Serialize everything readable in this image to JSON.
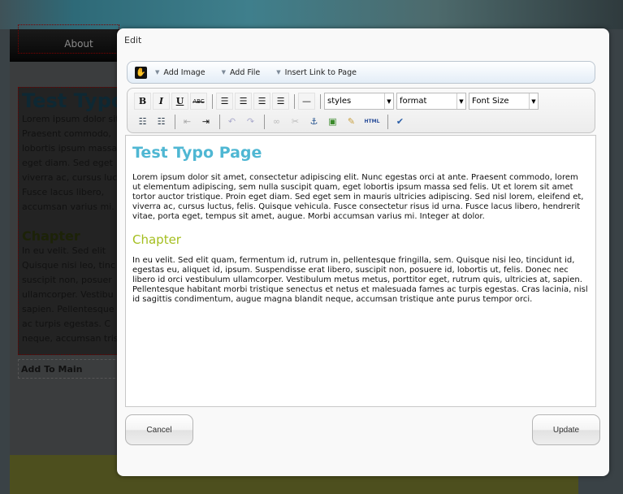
{
  "background_page": {
    "nav_item": "About",
    "content_title": "Test Typo",
    "content_lines": [
      "Lorem ipsum dolor sit",
      "Praesent commodo,",
      "lobortis ipsum massa",
      "eget diam. Sed eget",
      "viverra ac, cursus luc",
      "Fusce lacus libero,",
      "accumsan varius mi. I"
    ],
    "chapter": "Chapter",
    "chapter_lines": [
      "In eu velit. Sed elit",
      "Quisque nisi leo, tinc",
      "suscipit non, posuer",
      "ullamcorper. Vestibu",
      "sapien. Pellentesque",
      "ac turpis egestas. C",
      "neque, accumsan tris"
    ],
    "add_to_main": "Add To Main"
  },
  "dialog": {
    "title": "Edit",
    "toolbar_top": {
      "add_image": "Add Image",
      "add_file": "Add File",
      "insert_link": "Insert Link to Page"
    },
    "toolbar": {
      "bold": "B",
      "italic": "I",
      "underline": "U",
      "strike": "ABC",
      "html": "HTML",
      "styles": "styles",
      "format": "format",
      "font_size": "Font Size"
    },
    "editor": {
      "heading": "Test Typo Page",
      "para1": "Lorem ipsum dolor sit amet, consectetur adipiscing elit. Nunc egestas orci at ante. Praesent commodo, lorem ut elementum adipiscing, sem nulla suscipit quam, eget lobortis ipsum massa sed felis. Ut et lorem sit amet tortor auctor tristique. Proin eget diam. Sed eget sem in mauris ultricies adipiscing. Sed nisl lorem, eleifend et, viverra ac, cursus luctus, felis. Quisque vehicula. Fusce consectetur risus id urna. Fusce lacus libero, hendrerit vitae, porta eget, tempus sit amet, augue. Morbi accumsan varius mi. Integer at dolor.",
      "subheading": "Chapter",
      "para2": "In eu velit. Sed elit quam, fermentum id, rutrum in, pellentesque fringilla, sem. Quisque nisi leo, tincidunt id, egestas eu, aliquet id, ipsum. Suspendisse erat libero, suscipit non, posuere id, lobortis ut, felis. Donec nec libero id orci vestibulum ullamcorper. Vestibulum metus metus, porttitor eget, rutrum quis, ultricies at, sapien. Pellentesque habitant morbi tristique senectus et netus et malesuada fames ac turpis egestas. Cras lacinia, nisl id sagittis condimentum, augue magna blandit neque, accumsan tristique ante purus tempor orci."
    },
    "cancel": "Cancel",
    "update": "Update"
  },
  "colors": {
    "heading": "#4fb7d3",
    "subheading": "#a4be1e"
  }
}
